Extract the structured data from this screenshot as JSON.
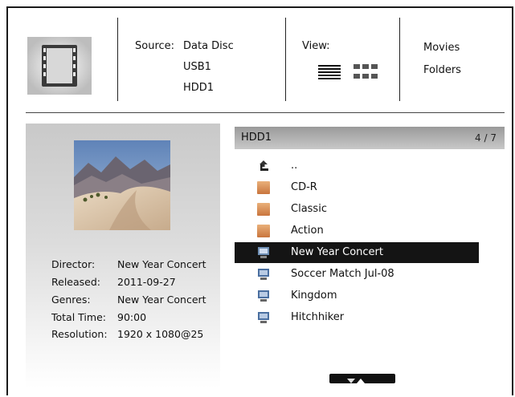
{
  "header": {
    "source_label": "Source:",
    "sources": [
      "Data Disc",
      "USB1",
      "HDD1"
    ],
    "view_label": "View:",
    "view_modes": [
      "list-view-icon",
      "grid-view-icon"
    ],
    "categories": [
      "Movies",
      "Folders"
    ]
  },
  "info": {
    "fields": [
      {
        "label": "Director:",
        "value": "New Year Concert"
      },
      {
        "label": "Released:",
        "value": "2011-09-27"
      },
      {
        "label": "Genres:",
        "value": "New Year Concert"
      },
      {
        "label": "Total Time:",
        "value": "90:00"
      },
      {
        "label": "Resolution:",
        "value": "1920 x 1080@25"
      }
    ]
  },
  "list": {
    "path": "HDD1",
    "position": "4 / 7",
    "items": [
      {
        "name": "..",
        "icon": "parent-folder-icon",
        "selected": false
      },
      {
        "name": "CD-R",
        "icon": "folder-icon",
        "selected": false
      },
      {
        "name": "Classic",
        "icon": "folder-icon",
        "selected": false
      },
      {
        "name": "Action",
        "icon": "folder-icon",
        "selected": false
      },
      {
        "name": "New Year Concert",
        "icon": "video-file-icon",
        "selected": true
      },
      {
        "name": "Soccer Match Jul-08",
        "icon": "video-file-icon",
        "selected": false
      },
      {
        "name": "Kingdom",
        "icon": "video-file-icon",
        "selected": false
      },
      {
        "name": "Hitchhiker",
        "icon": "video-file-icon",
        "selected": false
      }
    ]
  },
  "colors": {
    "selection": "#141414",
    "folder": "#d88a4e",
    "header_bar": "#a8a8a8"
  }
}
